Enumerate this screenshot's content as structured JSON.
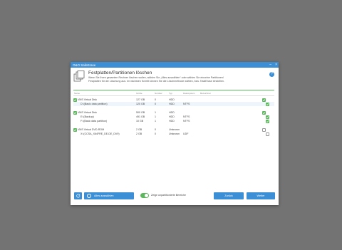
{
  "window": {
    "title": "O&O SafeErase"
  },
  "header": {
    "title": "Festplatten/Partitionen löschen",
    "desc_line1": "Wenn Sie Ihren gesamten Rechner löschen wollen, wählen Sie „Alles auswählen“ oder wählen Sie einzelne Partitionen/",
    "desc_line2": "Festplatten für die Löschung aus. Im nächsten Schritt können Sie die Löschmethode wählen, bzw. TotalErase einstellen."
  },
  "columns": [
    "Name",
    "Größe",
    "Number",
    "Typ",
    "Dateisystem",
    "Bezeichner"
  ],
  "disks": [
    {
      "name": "VMS Virtual Disk",
      "size": "127 GB",
      "number": "0",
      "type": "HDD",
      "fs": "",
      "checked": true,
      "partitions": [
        {
          "name": "D:\\(Basic data partition)",
          "size": "120 GB",
          "number": "0",
          "type": "HDD",
          "fs": "NTFS",
          "checked": true,
          "selected": true
        }
      ]
    },
    {
      "name": "VMS Virtual Disk",
      "size": "500 GB",
      "number": "1",
      "type": "HDD",
      "fs": "",
      "checked": true,
      "partitions": [
        {
          "name": "E:\\(Backup)",
          "size": "491 GB",
          "number": "1",
          "type": "HDD",
          "fs": "NTFS",
          "checked": true
        },
        {
          "name": "F:\\(Basic data partition)",
          "size": "10 GB",
          "number": "1",
          "type": "HDD",
          "fs": "NTFS",
          "checked": true
        }
      ]
    },
    {
      "name": "VMS Virtual DVD-ROM",
      "size": "2 GB",
      "number": "0",
      "type": "Unknown",
      "fs": "",
      "checked": false,
      "partitions": [
        {
          "name": "X:\\(CCSA_X64FRE_DE-DE_DV9)",
          "size": "2 GB",
          "number": "0",
          "type": "Unknown",
          "fs": "UDF",
          "checked": false
        }
      ]
    }
  ],
  "footer": {
    "select_all": "Alles auswählen",
    "toggle_label": "Zeige unpartitionierte Bereiche",
    "back": "Zurück",
    "next": "Weiter"
  },
  "colors": {
    "accent": "#3c8fd4",
    "check": "#5cb85c"
  }
}
